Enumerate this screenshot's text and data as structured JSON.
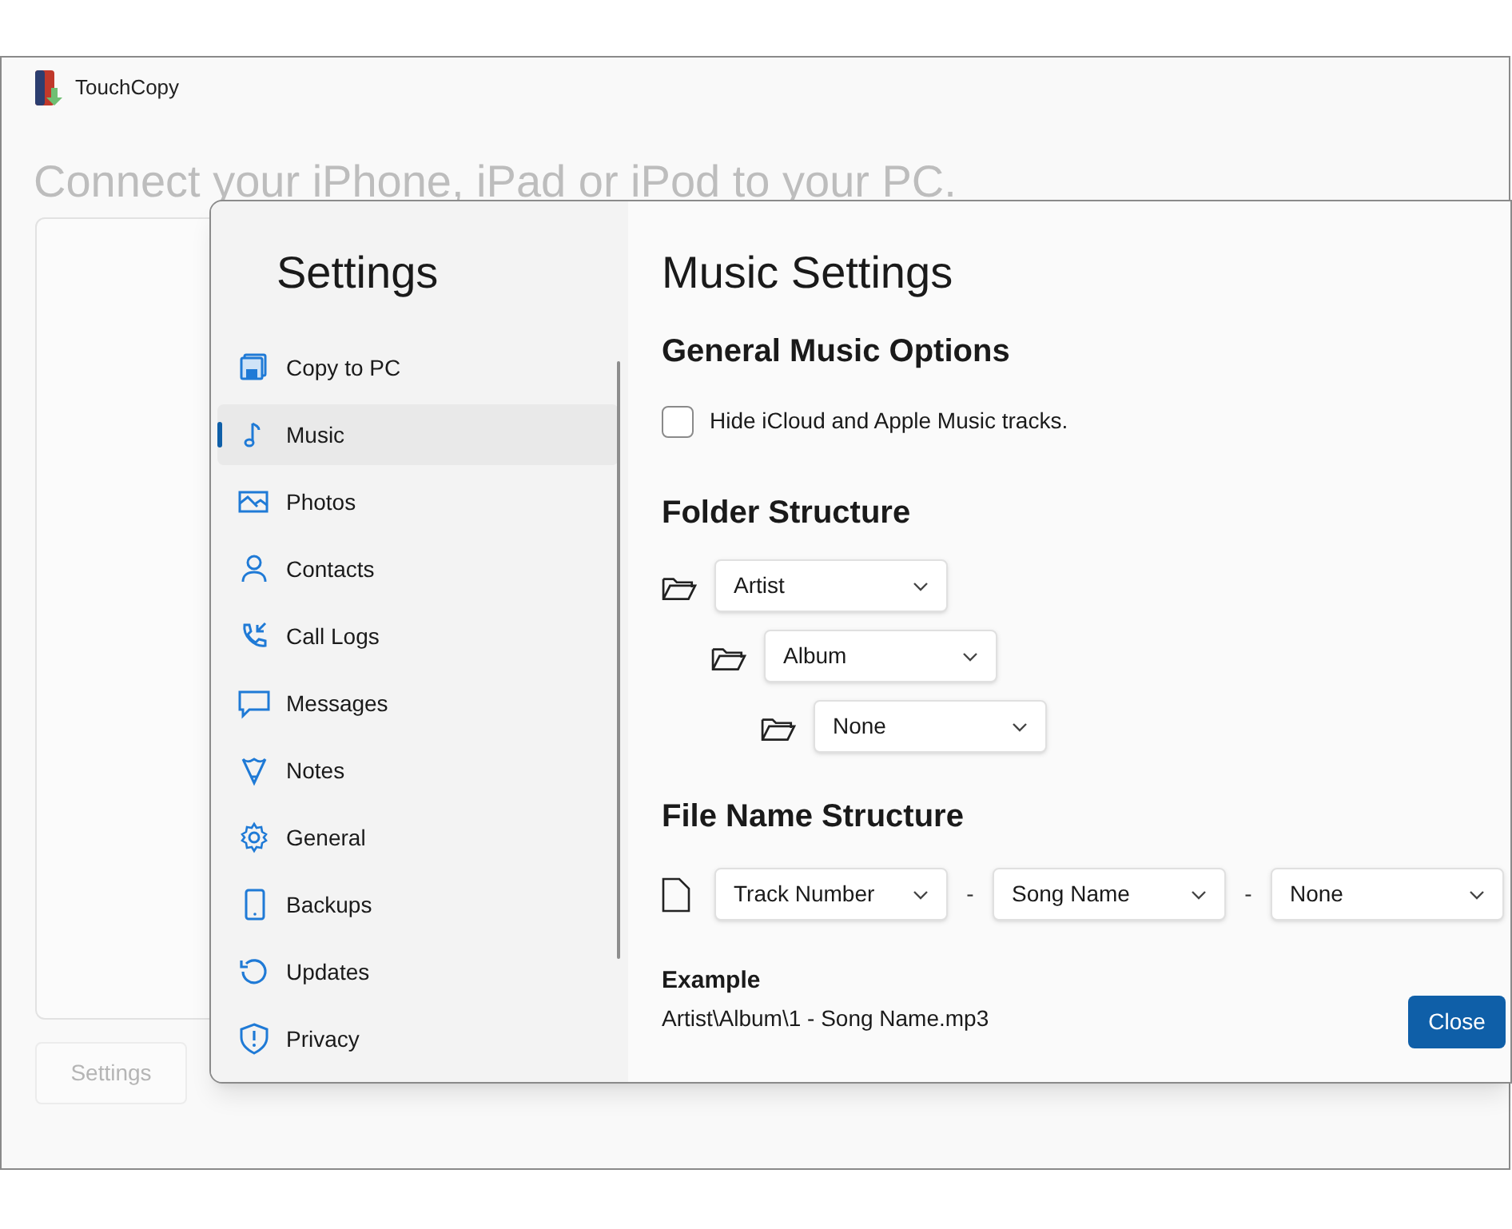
{
  "window": {
    "title": "TouchCopy"
  },
  "background": {
    "heading": "Connect your iPhone, iPad or iPod to your PC.",
    "settings_button": {
      "label": "Settings",
      "disabled": true
    }
  },
  "dialog": {
    "title": "Settings",
    "sidebar": {
      "items": [
        {
          "label": "Copy to PC",
          "selected": false
        },
        {
          "label": "Music",
          "selected": true
        },
        {
          "label": "Photos",
          "selected": false
        },
        {
          "label": "Contacts",
          "selected": false
        },
        {
          "label": "Call Logs",
          "selected": false
        },
        {
          "label": "Messages",
          "selected": false
        },
        {
          "label": "Notes",
          "selected": false
        },
        {
          "label": "General",
          "selected": false
        },
        {
          "label": "Backups",
          "selected": false
        },
        {
          "label": "Updates",
          "selected": false
        },
        {
          "label": "Privacy",
          "selected": false
        }
      ]
    },
    "page_title": "Music Settings",
    "general": {
      "heading": "General Music Options",
      "options": [
        {
          "label": "Hide iCloud and Apple Music tracks.",
          "checked": false
        }
      ]
    },
    "folder_structure": {
      "heading": "Folder Structure",
      "levels": [
        {
          "value": "Artist"
        },
        {
          "value": "Album"
        },
        {
          "value": "None"
        }
      ]
    },
    "file_name_structure": {
      "heading": "File Name Structure",
      "parts": [
        {
          "value": "Track Number"
        },
        {
          "value": "Song Name"
        },
        {
          "value": "None"
        }
      ],
      "separators": [
        "-",
        "-"
      ]
    },
    "example": {
      "label": "Example",
      "value": "Artist\\Album\\1 - Song Name.mp3"
    },
    "close_button": "Close"
  }
}
